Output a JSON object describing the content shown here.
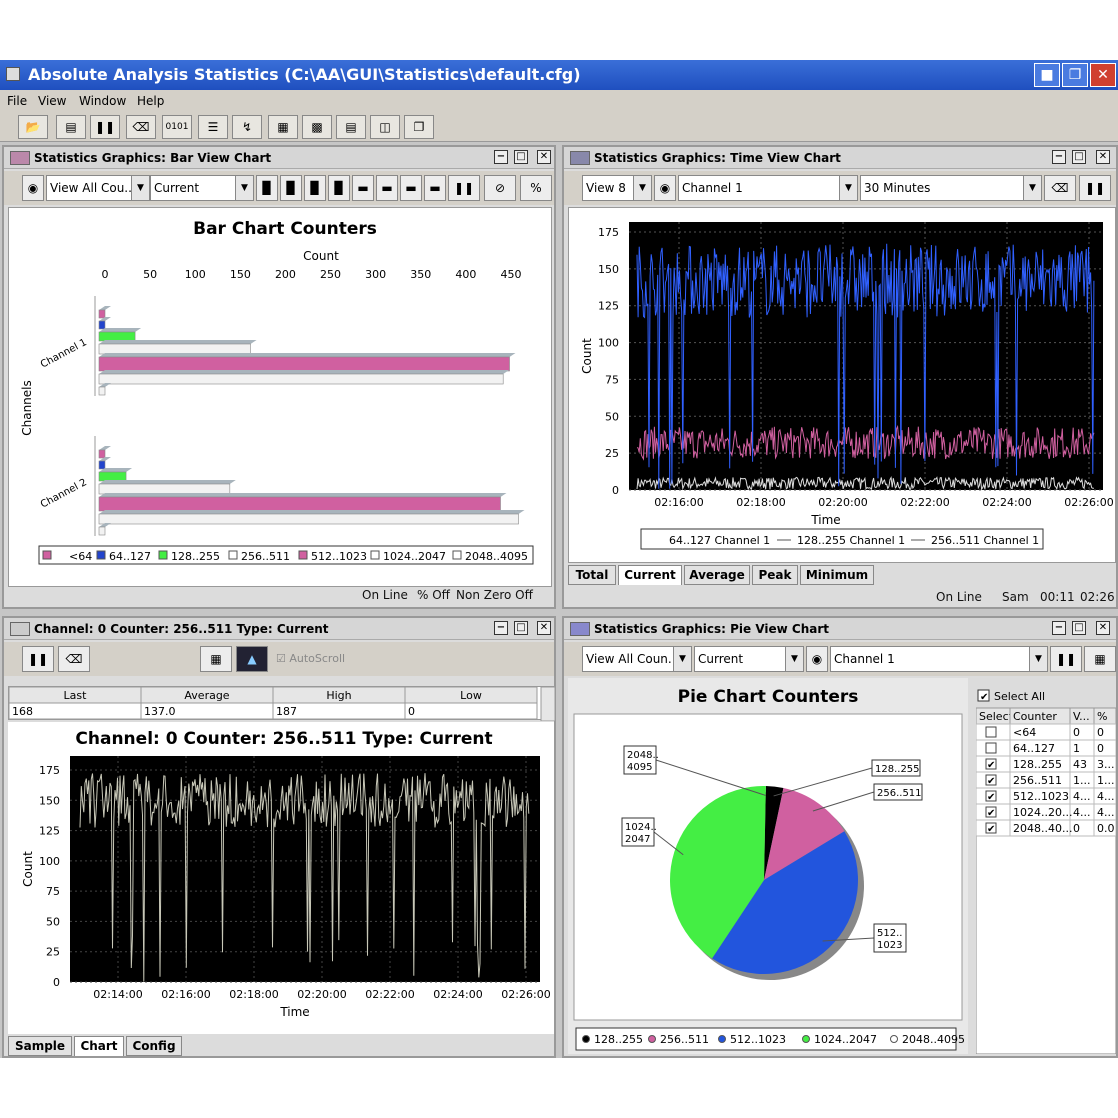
{
  "app": {
    "title": "Absolute Analysis Statistics (C:\\AA\\GUI\\Statistics\\default.cfg)"
  },
  "menu": [
    "File",
    "View",
    "Window",
    "Help"
  ],
  "toolbar": {
    "binary_label": "0101"
  },
  "bar_window": {
    "title": "Statistics Graphics: Bar View Chart",
    "view_select": "View All Cou...",
    "mode_select": "Current",
    "percent_label": "%",
    "status": {
      "online": "On Line",
      "percent": "% Off",
      "nonzero": "Non Zero Off"
    }
  },
  "time_window": {
    "title": "Statistics Graphics: Time View Chart",
    "view_select": "View 8",
    "channel_select": "Channel 1",
    "range_select": "30 Minutes",
    "tabs": [
      "Total",
      "Current",
      "Average",
      "Peak",
      "Minimum"
    ],
    "active_tab": "Current",
    "status": {
      "online": "On Line",
      "sam": "Sam",
      "time1": "00:11",
      "time2": "02:26"
    }
  },
  "counter_window": {
    "title": "Channel: 0 Counter:  256..511 Type: Current",
    "autoscroll_label": "AutoScroll",
    "table": {
      "headers": [
        "Last",
        "Average",
        "High",
        "Low"
      ],
      "values": [
        "168",
        "137.0",
        "187",
        "0"
      ]
    },
    "tabs": [
      "Sample",
      "Chart",
      "Config"
    ],
    "active_tab": "Chart"
  },
  "pie_window": {
    "title": "Statistics Graphics: Pie View Chart",
    "view_select": "View All Coun...",
    "mode_select": "Current",
    "channel_select": "Channel 1",
    "select_all_label": "Select All",
    "table": {
      "headers": [
        "Select",
        "Counter",
        "V...",
        "%"
      ],
      "rows": [
        {
          "checked": false,
          "counter": "<64",
          "v": "0",
          "pct": "0"
        },
        {
          "checked": false,
          "counter": "64..127",
          "v": "1",
          "pct": "0"
        },
        {
          "checked": true,
          "counter": "128..255",
          "v": "43",
          "pct": "3..."
        },
        {
          "checked": true,
          "counter": "256..511",
          "v": "1...",
          "pct": "1..."
        },
        {
          "checked": true,
          "counter": "512..1023",
          "v": "4...",
          "pct": "4..."
        },
        {
          "checked": true,
          "counter": "1024..20...",
          "v": "4...",
          "pct": "4..."
        },
        {
          "checked": true,
          "counter": "2048..40...",
          "v": "0",
          "pct": "0.0"
        }
      ]
    }
  },
  "chart_data": [
    {
      "type": "bar",
      "title": "Bar Chart Counters",
      "xlabel": "Count",
      "ylabel": "Channels",
      "xlim": [
        0,
        450
      ],
      "xticks": [
        0,
        50,
        100,
        150,
        200,
        250,
        300,
        350,
        400,
        450
      ],
      "categories": [
        "Channel 1",
        "Channel 2"
      ],
      "series": [
        {
          "name": "<64",
          "values": [
            0,
            0
          ],
          "color": "#d060a0"
        },
        {
          "name": "64..127",
          "values": [
            0,
            0
          ],
          "color": "#2244cc"
        },
        {
          "name": "128..255",
          "values": [
            40,
            30
          ],
          "color": "#44ee44"
        },
        {
          "name": "256..511",
          "values": [
            168,
            145
          ],
          "color": "#f2f2f2"
        },
        {
          "name": "512..1023",
          "values": [
            455,
            445
          ],
          "color": "#d060a0"
        },
        {
          "name": "1024..2047",
          "values": [
            448,
            465
          ],
          "color": "#f2f2f2"
        },
        {
          "name": "2048..4095",
          "values": [
            0,
            0
          ],
          "color": "#f2f2f2"
        }
      ],
      "legend": [
        "<64",
        "64..127",
        "128..255",
        "256..511",
        "512..1023",
        "1024..2047",
        "2048..4095"
      ],
      "legend_colors": [
        "#d060a0",
        "#2244cc",
        "#44ee44",
        "#ffffff",
        "#d060a0",
        "#ffffff",
        "#ffffff"
      ]
    },
    {
      "type": "line",
      "xlabel": "Time",
      "ylabel": "Count",
      "ylim": [
        0,
        175
      ],
      "yticks": [
        0,
        25,
        50,
        75,
        100,
        125,
        150,
        175
      ],
      "xticks": [
        "02:16:00",
        "02:18:00",
        "02:20:00",
        "02:22:00",
        "02:24:00",
        "02:26:00"
      ],
      "series": [
        {
          "name": "64..127 Channel 1",
          "approx_level": 142,
          "color": "#3060ff"
        },
        {
          "name": "128..255 Channel 1",
          "approx_level": 32,
          "color": "#d060a0"
        },
        {
          "name": "256..511 Channel 1",
          "approx_level": 3,
          "color": "#dddddd"
        }
      ],
      "legend": [
        "64..127 Channel 1",
        "128..255 Channel 1",
        "256..511 Channel 1"
      ]
    },
    {
      "type": "line",
      "title": "Channel: 0 Counter:  256..511 Type: Current",
      "xlabel": "Time",
      "ylabel": "Count",
      "ylim": [
        0,
        175
      ],
      "yticks": [
        0,
        25,
        50,
        75,
        100,
        125,
        150,
        175
      ],
      "xticks": [
        "02:14:00",
        "02:16:00",
        "02:18:00",
        "02:20:00",
        "02:22:00",
        "02:24:00",
        "02:26:00"
      ],
      "series": [
        {
          "approx_level": 150,
          "color": "#c8c8b8"
        }
      ]
    },
    {
      "type": "pie",
      "title": "Pie Chart Counters",
      "slices": [
        {
          "label": "128..255",
          "value": 3,
          "color": "#000000"
        },
        {
          "label": "256..511",
          "value": 13,
          "color": "#d060a0"
        },
        {
          "label": "512..1023",
          "value": 43,
          "color": "#2255dd"
        },
        {
          "label": "1024..2047",
          "value": 41,
          "color": "#44ee44"
        },
        {
          "label": "2048..4095",
          "value": 0,
          "color": "#ffffff"
        }
      ],
      "callouts": {
        "128..255": "128..255",
        "256..511": "256..511",
        "512..1023": "512..\n1023",
        "1024..2047": "1024..\n2047",
        "2048..4095": "2048..\n4095"
      },
      "legend": [
        "128..255",
        "256..511",
        "512..1023",
        "1024..2047",
        "2048..4095"
      ]
    }
  ]
}
